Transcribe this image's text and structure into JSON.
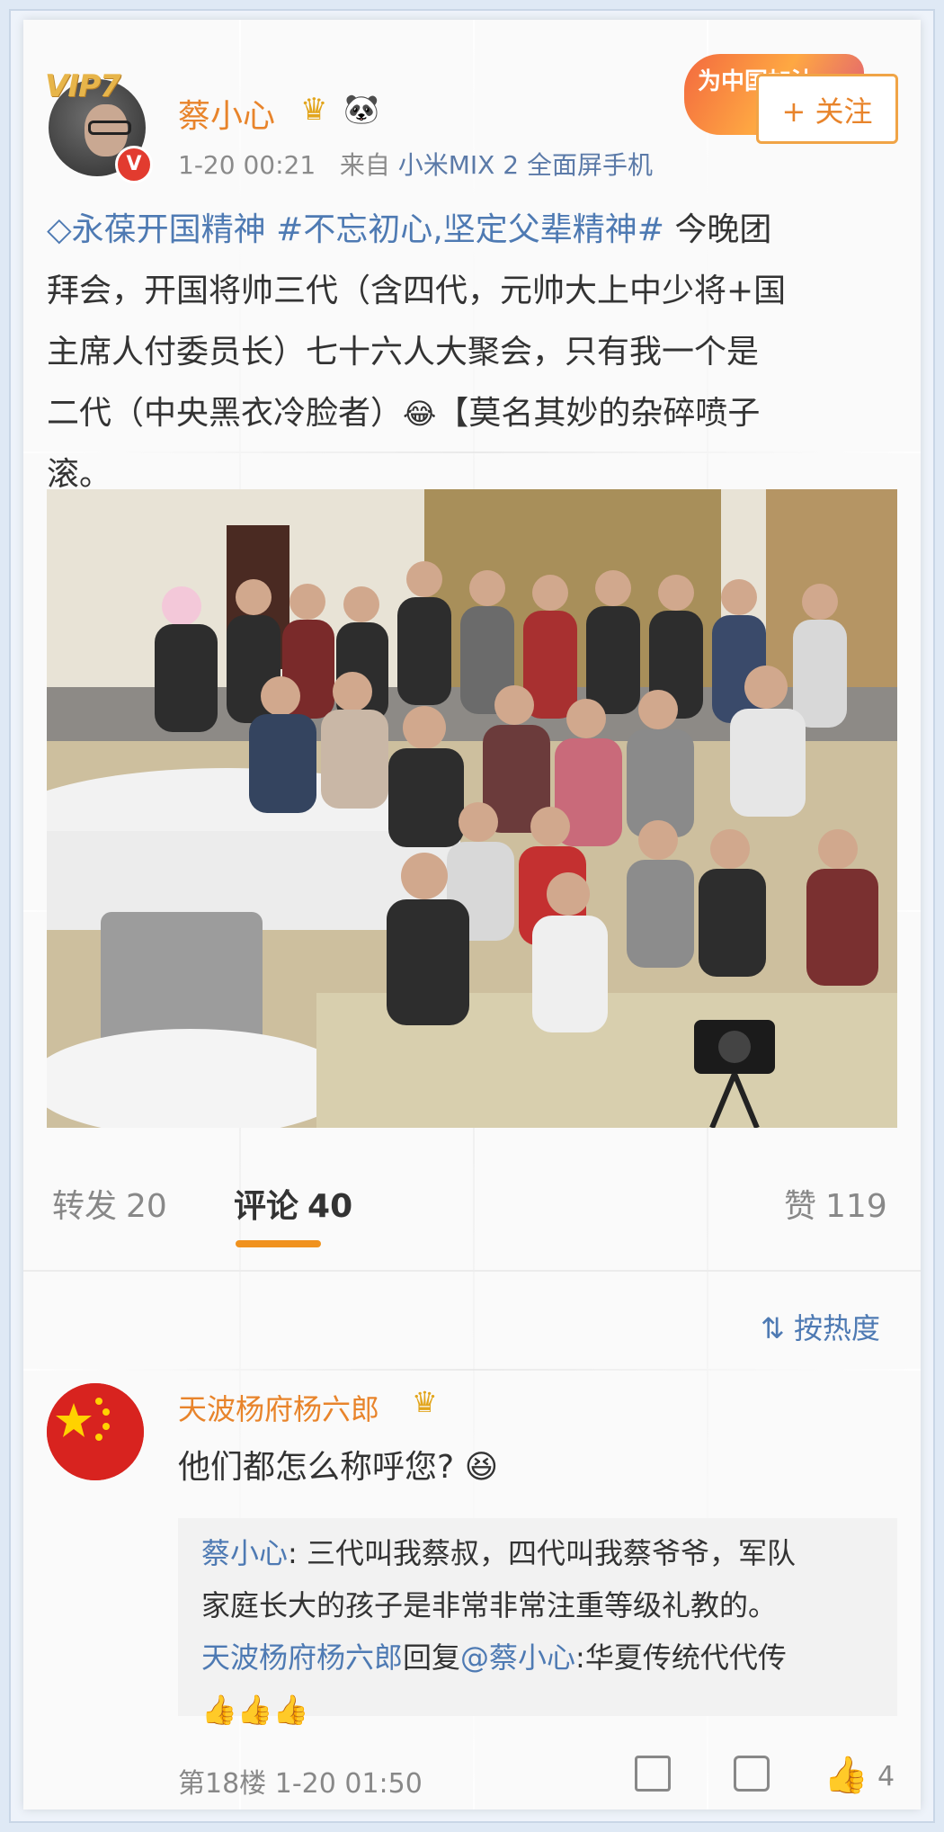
{
  "post": {
    "vip_label": "VIP7",
    "verified_badge": "V",
    "username": "蔡小心",
    "time": "1-20 00:21",
    "source_prefix": "来自",
    "source": "小米MIX 2 全面屏手机",
    "promo_label": "为中国加油",
    "follow_label": "+ 关注",
    "text": {
      "tag1": "◇永葆开国精神",
      "tag2": "#不忘初心,坚定父辈精神#",
      "line1_rest": " 今晚团",
      "line2": "拜会，开国将帅三代（含四代，元帅大上中少将+国",
      "line3": "主席人付委员长）七十六人大聚会，只有我一个是",
      "line4a": "二代（中央黑衣冷脸者）",
      "line4b": "【莫名其妙的杂碎喷子",
      "line5": "滚。"
    }
  },
  "stats": {
    "repost_label": "转发",
    "repost_count": "20",
    "comment_label": "评论",
    "comment_count": "40",
    "like_label": "赞",
    "like_count": "119"
  },
  "comments": {
    "sort_label": "按热度",
    "commenter": "天波杨府杨六郎",
    "comment_text": "他们都怎么称呼您?",
    "reply1_user": "蔡小心",
    "reply1_text": ": 三代叫我蔡叔，四代叫我蔡爷爷，军队",
    "reply1_text2": "家庭长大的孩子是非常非常注重等级礼教的。",
    "reply2_user": "天波杨府杨六郎",
    "reply2_mid": "回复",
    "reply2_at": "@蔡小心",
    "reply2_text": ":华夏传统代代传",
    "floor": "第18楼",
    "comment_time": "1-20 01:50",
    "comment_likes": "4"
  },
  "colors": {
    "accent_orange": "#e8842b",
    "link_blue": "#4e7ab3",
    "active_underline": "#f0921e"
  },
  "icons": [
    "crown-icon",
    "panda-icon",
    "verified-icon",
    "sort-icon",
    "share-icon",
    "comment-icon",
    "like-icon",
    "thumbs-up-emoji",
    "laugh-emoji"
  ]
}
